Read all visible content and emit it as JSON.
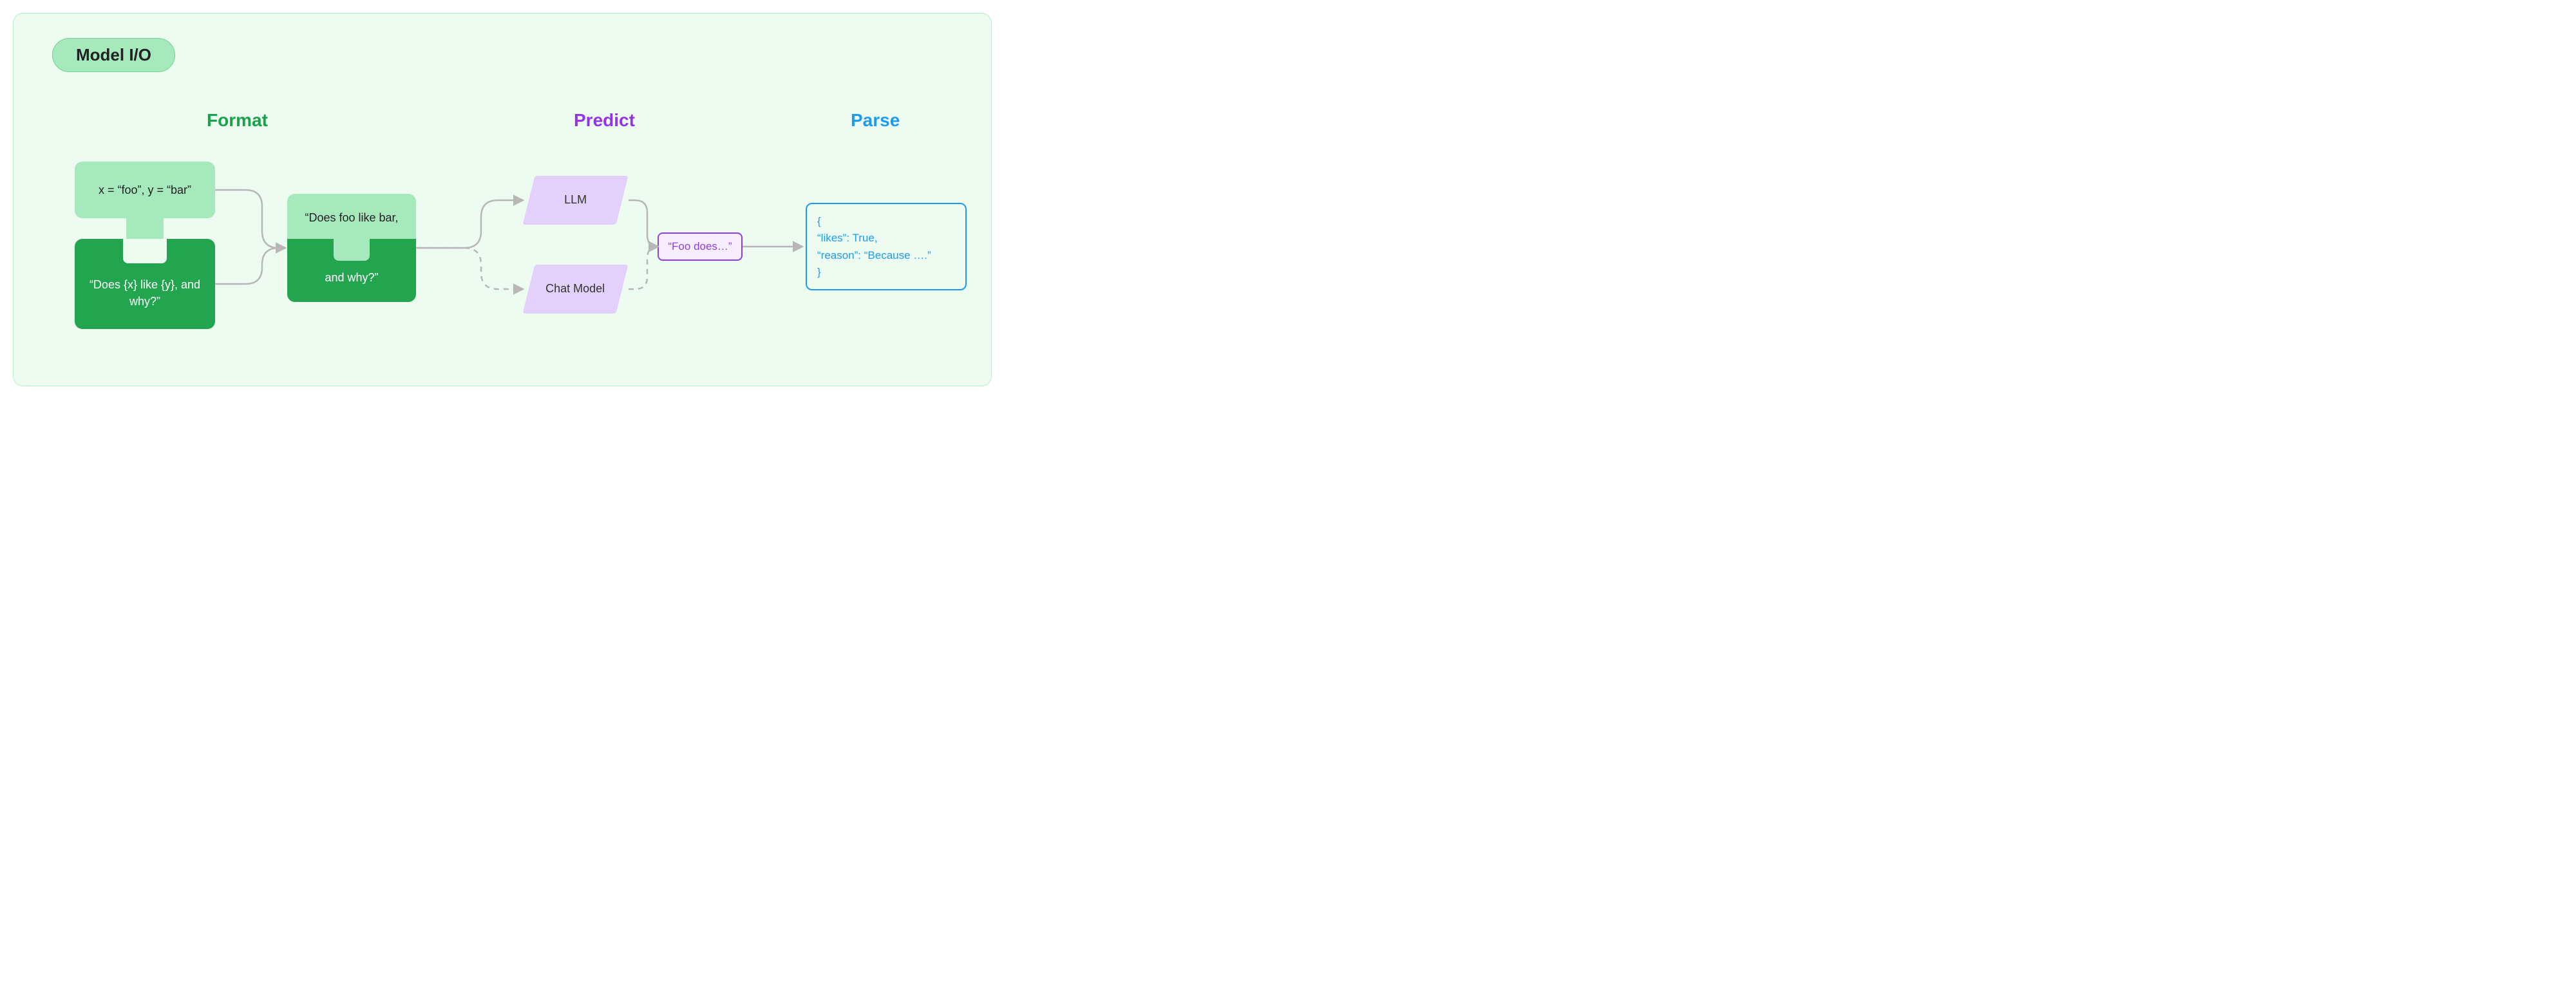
{
  "badge": "Model I/O",
  "sections": {
    "format": "Format",
    "predict": "Predict",
    "parse": "Parse"
  },
  "format": {
    "vars": "x = “foo”, y = “bar”",
    "template": "“Does {x} like {y},\nand why?”",
    "prompt_top": "“Does foo like bar,",
    "prompt_bot": "and why?”"
  },
  "predict": {
    "llm": "LLM",
    "chat": "Chat\nModel",
    "output": "“Foo does…”"
  },
  "parse": {
    "json": "{\n   “likes”: True,\n   “reason”: “Because ….”\n}"
  },
  "colors": {
    "panelBg": "#edfbf1",
    "panelBorder": "#b6efc9",
    "lightGreen": "#a6e9bd",
    "darkGreen": "#23a44e",
    "formatText": "#19a24a",
    "predictText": "#9333ea",
    "parseText": "#1d9bf0",
    "lilac": "#e3d0fb",
    "arrow": "#b7b7b7"
  }
}
